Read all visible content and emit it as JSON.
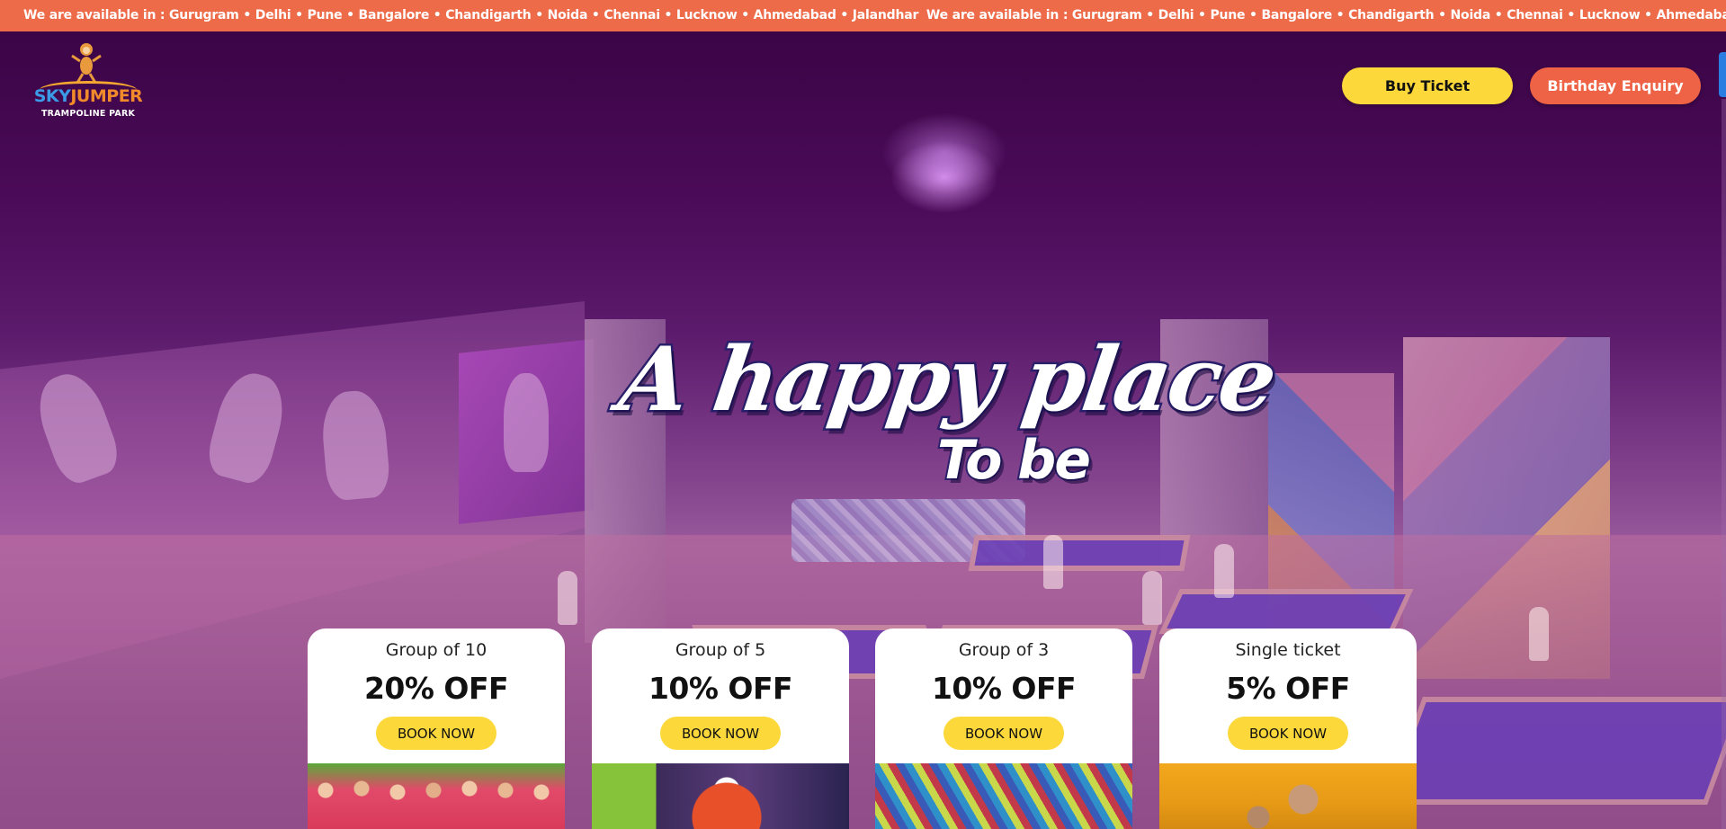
{
  "ticker": {
    "text": "We are available in : Gurugram • Delhi • Pune • Bangalore • Chandigarth • Noida • Chennai • Lucknow • Ahmedabad • Jalandhar",
    "text_repeat": "We are available in : Gurugram • Delhi • Pune • Bangalore • Chandigarth • Noida • Chennai • Lucknow • Ahmedabad • Jalandhar"
  },
  "logo": {
    "brand_part1": "SKY",
    "brand_part2": "JUMPER",
    "subtitle": "TRAMPOLINE PARK"
  },
  "header": {
    "buy_ticket_label": "Buy Ticket",
    "birthday_enquiry_label": "Birthday Enquiry"
  },
  "hero": {
    "headline": "A happy place",
    "headline_sub": "To be"
  },
  "offers": [
    {
      "title": "Group of 10",
      "discount": "20% OFF",
      "cta": "BOOK NOW"
    },
    {
      "title": "Group of 5",
      "discount": "10% OFF",
      "cta": "BOOK NOW"
    },
    {
      "title": "Group of 3",
      "discount": "10% OFF",
      "cta": "BOOK NOW"
    },
    {
      "title": "Single ticket",
      "discount": "5% OFF",
      "cta": "BOOK NOW"
    }
  ],
  "colors": {
    "ticker_bg": "#ee6b4a",
    "buy_ticket_bg": "#fcd83a",
    "birthday_bg": "#ee6345",
    "hero_overlay": "#3b0546"
  },
  "icons": [
    "monkey-mascot-icon"
  ]
}
